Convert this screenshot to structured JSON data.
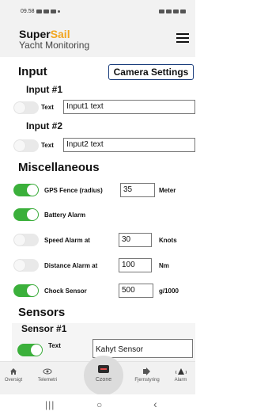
{
  "status_bar": {
    "time": "09.58",
    "battery_text": ""
  },
  "header": {
    "brand_part1": "Super",
    "brand_part2": "Sail",
    "subtitle": "Yacht Monitoring"
  },
  "colors": {
    "toggle_on": "#3bb03b",
    "brand_accent": "#f2a51f"
  },
  "input": {
    "title": "Input",
    "camera_settings_label": "Camera Settings",
    "items": [
      {
        "title": "Input #1",
        "toggle_on": false,
        "text_label": "Text",
        "value": "Input1 text"
      },
      {
        "title": "Input #2",
        "toggle_on": false,
        "text_label": "Text",
        "value": "Input2 text"
      }
    ]
  },
  "misc": {
    "title": "Miscellaneous",
    "gps_fence": {
      "label": "GPS Fence (radius)",
      "value": "35",
      "unit": "Meter",
      "toggle_on": true
    },
    "battery_alarm": {
      "label": "Battery Alarm",
      "toggle_on": true
    },
    "speed_alarm": {
      "label": "Speed Alarm at",
      "value": "30",
      "unit": "Knots",
      "toggle_on": false
    },
    "distance_alarm": {
      "label": "Distance Alarm at",
      "value": "100",
      "unit": "Nm",
      "toggle_on": false
    },
    "chock_sensor": {
      "label": "Chock Sensor",
      "value": "500",
      "unit": "g/1000",
      "toggle_on": true
    }
  },
  "sensors": {
    "title": "Sensors",
    "items": [
      {
        "title": "Sensor #1",
        "toggle_on": true,
        "text_label": "Text",
        "value": "Kahyt Sensor"
      }
    ]
  },
  "bottom_nav": [
    {
      "label": "Oversigt",
      "icon": "home-icon"
    },
    {
      "label": "Telemetri",
      "icon": "eye-icon"
    },
    {
      "label": "Czone",
      "icon": "czone-icon"
    },
    {
      "label": "Fjernstyring",
      "icon": "remote-icon"
    },
    {
      "label": "Alarm",
      "icon": "alarm-icon"
    }
  ],
  "system_nav": {
    "recents": "|||",
    "home": "○",
    "back": "‹"
  }
}
